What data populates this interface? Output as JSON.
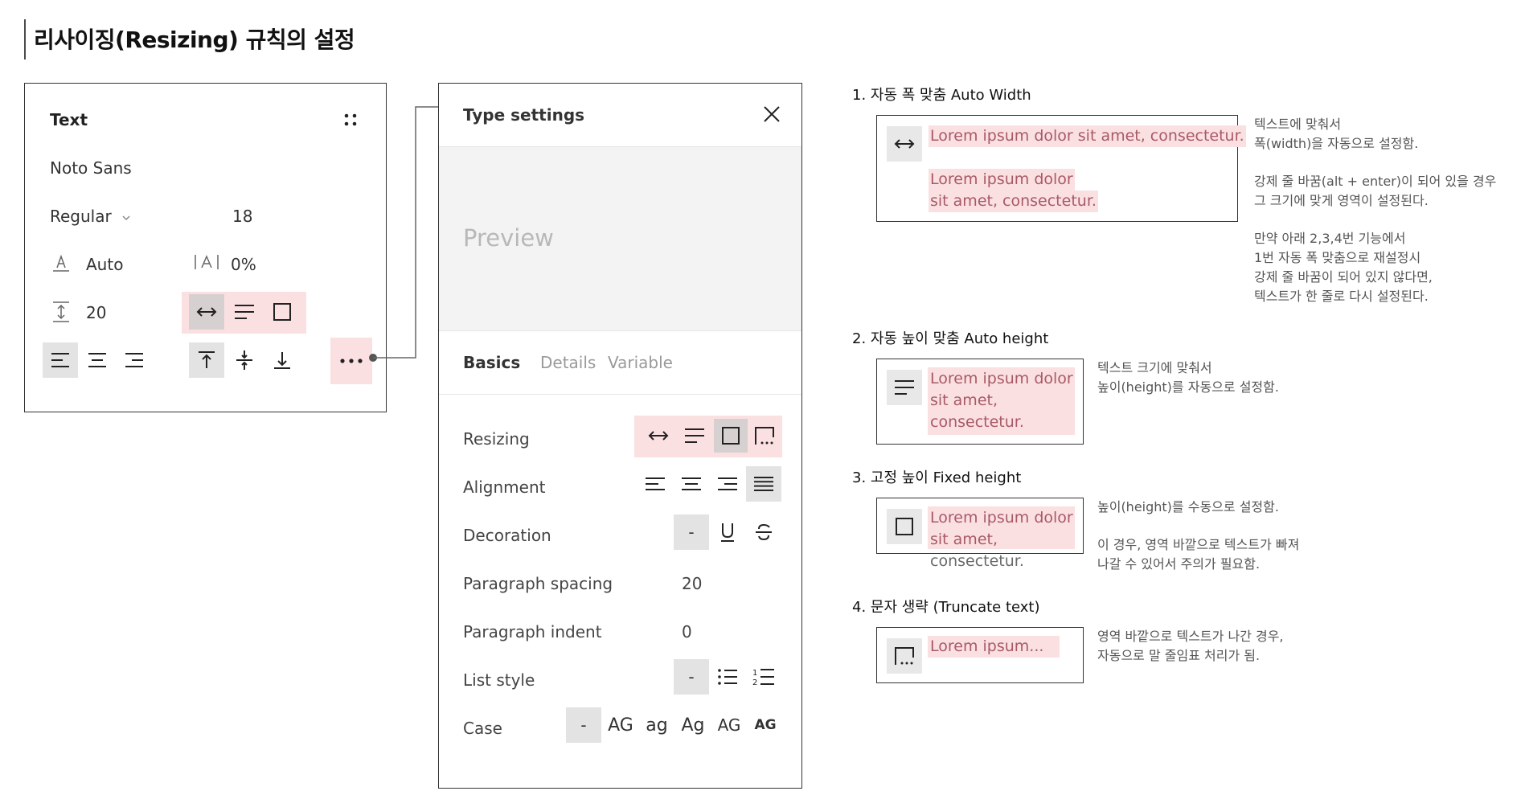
{
  "page": {
    "title": "리사이징(Resizing) 규칙의 설정"
  },
  "text_panel": {
    "heading": "Text",
    "font_family": "Noto Sans",
    "font_weight": "Regular",
    "font_size": "18",
    "line_height": "Auto",
    "letter_spacing": "0%",
    "paragraph_spacing": "20"
  },
  "type_settings": {
    "title": "Type settings",
    "preview": "Preview",
    "tabs": [
      {
        "label": "Basics",
        "active": true
      },
      {
        "label": "Details",
        "active": false
      },
      {
        "label": "Variable",
        "active": false
      }
    ],
    "rows": {
      "resizing": "Resizing",
      "alignment": "Alignment",
      "decoration": "Decoration",
      "paragraph_spacing": "Paragraph spacing",
      "paragraph_spacing_value": "20",
      "paragraph_indent": "Paragraph indent",
      "paragraph_indent_value": "0",
      "list_style": "List style",
      "case": "Case"
    },
    "none_symbol": "-",
    "case_options": [
      "AG",
      "ag",
      "Ag",
      "AG",
      "AG"
    ]
  },
  "sections": [
    {
      "title": "1. 자동 폭 맞춤 Auto Width",
      "sample_wide": "Lorem ipsum dolor sit amet, consectetur.",
      "sample_line1": "Lorem ipsum dolor",
      "sample_line2": "sit amet, consectetur.",
      "notes": [
        "텍스트에 맞춰서",
        "폭(width)을 자동으로 설정함.",
        "강제 줄 바꿈(alt + enter)이 되어 있을 경우",
        "그 크기에 맞게 영역이 설정된다.",
        "만약 아래 2,3,4번 기능에서",
        "1번 자동 폭 맞춤으로 재설정시",
        "강제 줄 바꿈이 되어 있지 않다면,",
        "텍스트가 한 줄로 다시 설정된다."
      ]
    },
    {
      "title": "2. 자동 높이 맞춤 Auto height",
      "sample_lines": [
        "Lorem ipsum dolor",
        "sit amet,",
        "consectetur."
      ],
      "notes": [
        "텍스트 크기에 맞춰서",
        "높이(height)를 자동으로 설정함."
      ]
    },
    {
      "title": "3. 고정 높이 Fixed height",
      "sample_lines": [
        "Lorem ipsum dolor",
        "sit amet,",
        "consectetur."
      ],
      "notes": [
        "높이(height)를 수동으로 설정함.",
        "이 경우, 영역 바깥으로 텍스트가 빠져",
        "나갈 수 있어서 주의가 필요함."
      ]
    },
    {
      "title": "4. 문자 생략 (Truncate text)",
      "sample": "Lorem ipsum...",
      "notes": [
        "영역 바깥으로 텍스트가 나간 경우,",
        "자동으로 말 줄임표 처리가 됨."
      ]
    }
  ],
  "colors": {
    "highlight": "#fbe0e2",
    "sample_text": "#a85a66",
    "selected_bg": "#e3e3e3",
    "border": "#333333"
  }
}
